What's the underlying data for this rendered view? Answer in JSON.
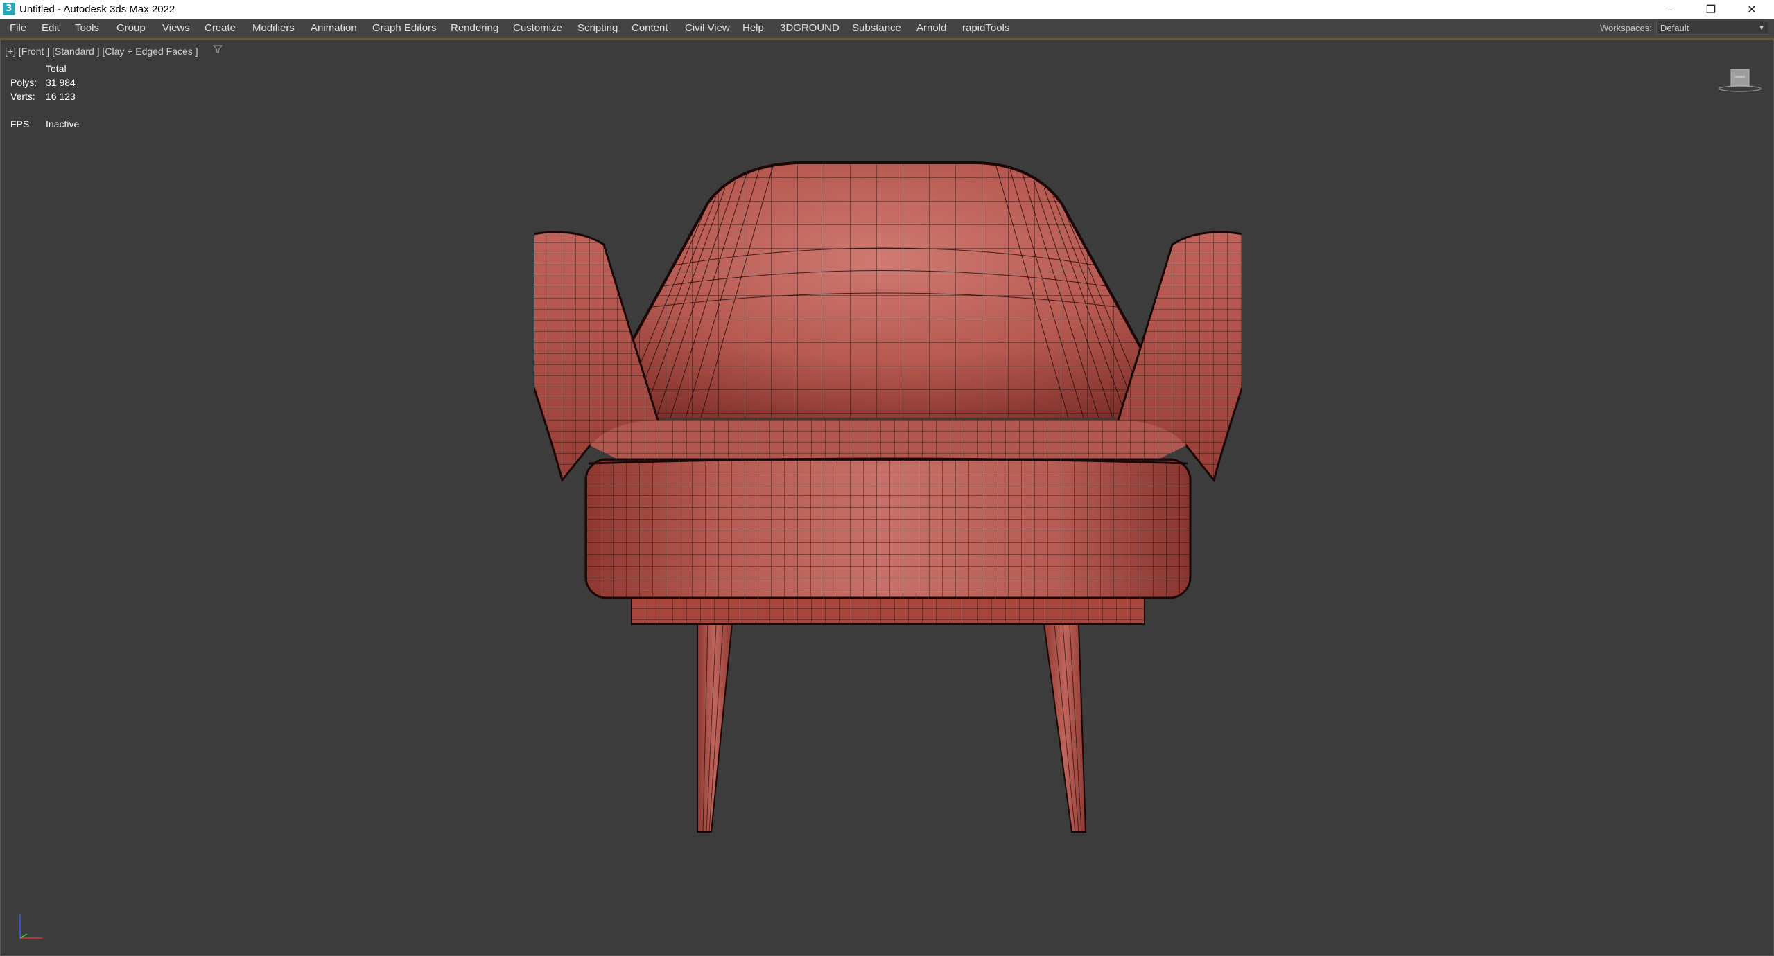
{
  "window": {
    "title": "Untitled - Autodesk 3ds Max 2022",
    "app_icon_glyph": "3",
    "controls": {
      "minimize": "–",
      "restore": "❐",
      "close": "✕"
    }
  },
  "menu": [
    "File",
    "Edit",
    "Tools",
    "Group",
    "Views",
    "Create",
    "Modifiers",
    "Animation",
    "Graph Editors",
    "Rendering",
    "Customize",
    "Scripting",
    "Content",
    "Civil View",
    "Help",
    "3DGROUND",
    "Substance",
    "Arnold",
    "rapidTools"
  ],
  "workspaces": {
    "label": "Workspaces:",
    "value": "Default"
  },
  "viewport": {
    "label": "[+] [Front ] [Standard ] [Clay + Edged Faces ]",
    "stats": {
      "total_label": "Total",
      "polys_label": "Polys:",
      "polys_value": "31 984",
      "verts_label": "Verts:",
      "verts_value": "16 123",
      "fps_label": "FPS:",
      "fps_value": "Inactive"
    }
  },
  "colors": {
    "viewport_bg": "#3c3c3c",
    "clay_red": "#b4524a",
    "wire": "#1e0908",
    "menu_accent": "#6b5a2a"
  },
  "icons": [
    "filter-icon",
    "viewcube-icon",
    "axis-tripod-icon"
  ]
}
